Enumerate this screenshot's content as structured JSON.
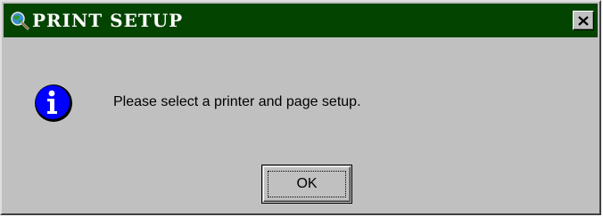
{
  "dialog": {
    "title": "PRINT SETUP",
    "title_icon": "magnifier-globe-icon",
    "close_icon": "close-icon",
    "message_icon": "info-icon",
    "message": "Please select a printer and page setup.",
    "ok_label": "OK"
  },
  "colors": {
    "titlebar": "#034401",
    "dialog_bg": "#c0c0c0",
    "info_icon_blue": "#0000ff"
  }
}
